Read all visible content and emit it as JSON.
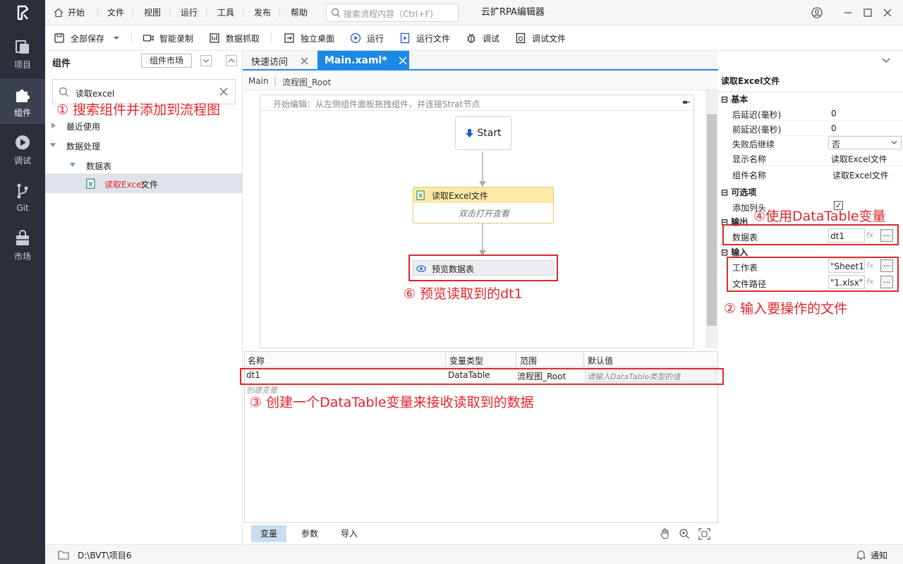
{
  "app_title": "云扩RPA编辑器",
  "nav": {
    "project": "项目",
    "components": "组件",
    "debug": "调试",
    "git": "Git",
    "market": "市场"
  },
  "menu": {
    "home": "开始",
    "file": "文件",
    "view": "视图",
    "run": "运行",
    "tools": "工具",
    "publish": "发布",
    "help": "帮助",
    "search_placeholder": "搜索流程内容（Ctrl+F)"
  },
  "toolbar": {
    "save_all": "全部保存",
    "smart_record": "智能录制",
    "data_scrape": "数据抓取",
    "standalone_desktop": "独立桌面",
    "run": "运行",
    "run_file": "运行文件",
    "debug": "调试",
    "debug_file": "调试文件"
  },
  "left_panel": {
    "title": "组件",
    "market_button": "组件市场",
    "search_value": "读取excel",
    "tree": {
      "recent": "最近使用",
      "data_processing": "数据处理",
      "datatable": "数据表",
      "leaf_highlight": "读取Excel",
      "leaf_rest": "文件"
    }
  },
  "tabs": {
    "quick_access": "快速访问",
    "main": "Main.xaml*"
  },
  "breadcrumb": {
    "root": "Main",
    "current": "流程图_Root"
  },
  "canvas": {
    "hint": "开始编辑：从左侧组件面板拖拽组件，并连接Strat节点",
    "start_label": "Start",
    "read_excel_title": "读取Excel文件",
    "read_excel_body": "双击打开查看",
    "preview_title": "预览数据表"
  },
  "variables": {
    "headers": [
      "名称",
      "变量类型",
      "范围",
      "默认值"
    ],
    "row": {
      "name": "dt1",
      "type": "DataTable",
      "scope": "流程图_Root",
      "default_placeholder": "请输入DataTable类型的值"
    },
    "create_hint": "创建变量",
    "bottom_tabs": [
      "变量",
      "参数",
      "导入"
    ]
  },
  "properties": {
    "title": "读取Excel文件",
    "section_basic": "基本",
    "delay_after_label": "后延迟(毫秒)",
    "delay_after_value": "0",
    "delay_before_label": "前延迟(毫秒)",
    "delay_before_value": "0",
    "continue_on_error_label": "失败后继续",
    "continue_on_error_value": "否",
    "display_name_label": "显示名称",
    "display_name_value": "读取Excel文件",
    "component_name_label": "组件名称",
    "component_name_value": "读取Excel文件",
    "section_options": "可选项",
    "add_headers_label": "添加列头",
    "add_headers_checked": true,
    "section_output": "输出",
    "datatable_label": "数据表",
    "datatable_value": "dt1",
    "section_input": "输入",
    "sheet_label": "工作表",
    "sheet_value": "\"Sheet1\"",
    "filepath_label": "文件路径",
    "filepath_value": "\"1.xlsx\"",
    "fx": "fx",
    "ellipsis": "..."
  },
  "annotations": {
    "a1": "① 搜索组件并添加到流程图",
    "a2": "② 输入要操作的文件",
    "a3": "③ 创建一个DataTable变量来接收读取到的数据",
    "a4": "④使用DataTable变量",
    "a6": "⑥ 预览读取到的dt1"
  },
  "status": {
    "path": "D:\\BVT\\项目6",
    "notify": "通知"
  },
  "colors": {
    "sidebar_bg": "#2b2f3a",
    "accent_blue": "#1e88e5",
    "annotation_red": "#e0262b",
    "activity_header": "#fbe9a8"
  }
}
